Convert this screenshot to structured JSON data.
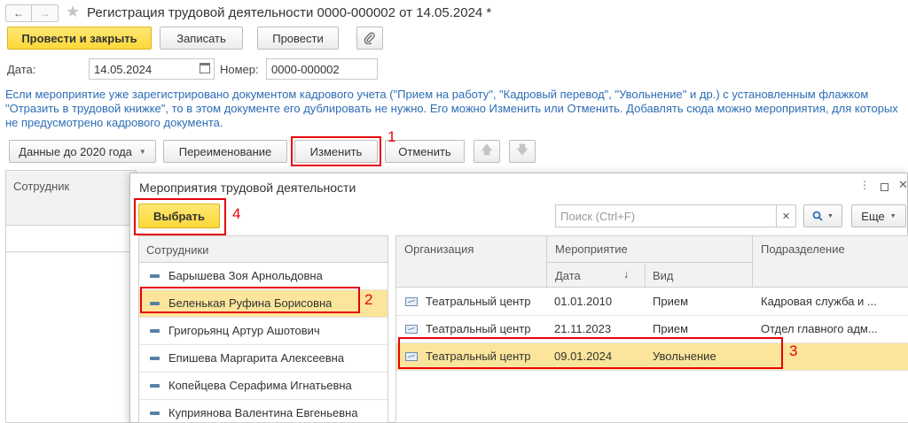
{
  "window": {
    "title": "Регистрация трудовой деятельности 0000-000002 от 14.05.2024 *"
  },
  "toolbar": {
    "post_close": "Провести и закрыть",
    "save": "Записать",
    "post": "Провести"
  },
  "form": {
    "date_label": "Дата:",
    "date_value": "14.05.2024",
    "number_label": "Номер:",
    "number_value": "0000-000002"
  },
  "info_text": "Если мероприятие уже зарегистрировано документом кадрового учета (\"Прием на работу\", \"Кадровый перевод\", \"Увольнение\" и др.) с установленным флажком \"Отразить в трудовой книжке\", то в этом документе его дублировать не нужно. Его можно Изменить или Отменить. Добавлять сюда можно мероприятия, для которых не предусмотрено кадрового документа.",
  "actions": {
    "data_before_2020": "Данные до 2020 года",
    "rename": "Переименование",
    "change": "Изменить",
    "cancel": "Отменить"
  },
  "main_table": {
    "col_employee": "Сотрудник"
  },
  "dialog": {
    "title": "Мероприятия трудовой деятельности",
    "select": "Выбрать",
    "search_placeholder": "Поиск (Ctrl+F)",
    "more": "Еще",
    "employees_header": "Сотрудники",
    "employees": [
      "Барышева Зоя Арнольдовна",
      "Беленькая Руфина Борисовна",
      "Григорьянц Артур Ашотович",
      "Епишева Маргарита Алексеевна",
      "Копейцева Серафима Игнатьевна",
      "Куприянова Валентина Евгеньевна"
    ],
    "events": {
      "col_org": "Организация",
      "col_event": "Мероприятие",
      "col_date": "Дата",
      "col_kind": "Вид",
      "col_dept": "Подразделение",
      "rows": [
        {
          "org": "Театральный центр",
          "date": "01.01.2010",
          "kind": "Прием",
          "dept": "Кадровая служба и ..."
        },
        {
          "org": "Театральный центр",
          "date": "21.11.2023",
          "kind": "Прием",
          "dept": "Отдел главного адм..."
        },
        {
          "org": "Театральный центр",
          "date": "09.01.2024",
          "kind": "Увольнение",
          "dept": ""
        }
      ]
    }
  },
  "callouts": [
    "1",
    "2",
    "3",
    "4"
  ],
  "colors": {
    "accent_yellow": "#fcd839",
    "selected_row": "#fbe59b",
    "highlight": "#e8000b",
    "info_text": "#2c6db5"
  }
}
